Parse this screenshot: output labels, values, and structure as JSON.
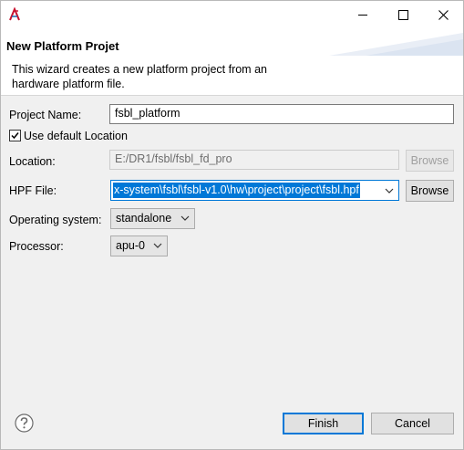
{
  "window": {
    "title_icon": "eclipse-xilinx-icon",
    "controls": {
      "minimize_icon": "minimize-icon",
      "maximize_icon": "maximize-icon",
      "close_icon": "close-icon"
    }
  },
  "banner": {
    "title": "New Platform Projet",
    "description": "This wizard creates a new platform project from an hardware platform file."
  },
  "form": {
    "project_name_label": "Project Name:",
    "project_name_value": "fsbl_platform",
    "use_default_label": "Use default Location",
    "use_default_checked": true,
    "location_label": "Location:",
    "location_value": "E:/DR1/fsbl/fsbl_fd_pro",
    "location_browse": "Browse",
    "hpf_label": "HPF File:",
    "hpf_value": "x-system\\fsbl\\fsbl-v1.0\\hw\\project\\project\\fsbl.hpf",
    "hpf_browse": "Browse",
    "os_label": "Operating system:",
    "os_value": "standalone",
    "processor_label": "Processor:",
    "processor_value": "apu-0"
  },
  "footer": {
    "help_icon": "help-icon",
    "finish_label": "Finish",
    "cancel_label": "Cancel"
  },
  "colors": {
    "selection": "#0078d7",
    "dialog_bg": "#f0f0f0",
    "banner_bg": "#ffffff"
  }
}
